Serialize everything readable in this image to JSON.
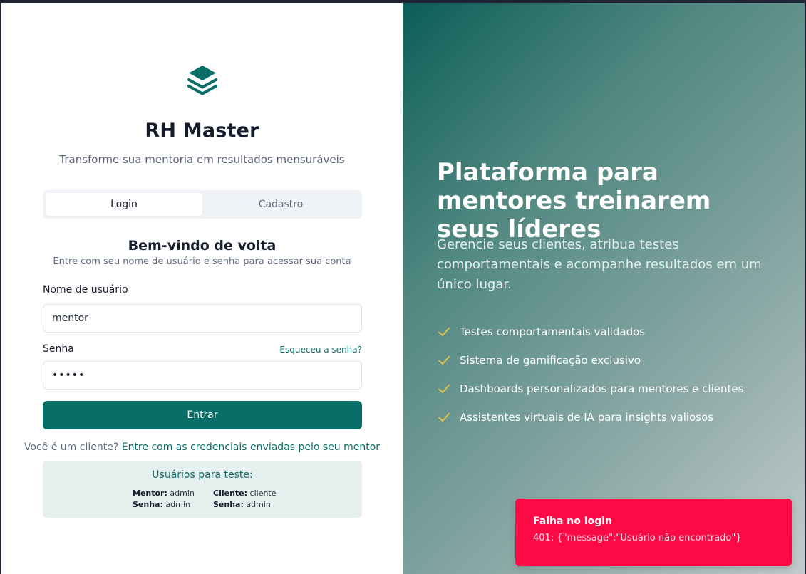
{
  "brand": {
    "app_name": "RH Master",
    "tagline": "Transforme sua mentoria em resultados mensuráveis",
    "icon": "layers-icon",
    "accent_color": "#0a6e68"
  },
  "tabs": [
    {
      "label": "Login",
      "active": true
    },
    {
      "label": "Cadastro",
      "active": false
    }
  ],
  "login": {
    "heading": "Bem-vindo de volta",
    "subheading": "Entre com seu nome de usuário e senha para acessar sua conta",
    "username_label": "Nome de usuário",
    "username_value": "mentor",
    "password_label": "Senha",
    "password_value": "•••••",
    "forgot_link": "Esqueceu a senha?",
    "submit_label": "Entrar",
    "client_prompt": "Você é um cliente?",
    "client_link": "Entre com as credenciais enviadas pelo seu mentor"
  },
  "test_users": {
    "title": "Usuários para teste:",
    "mentor_key": "Mentor:",
    "mentor_user": "admin",
    "mentor_pass_key": "Senha:",
    "mentor_pass": "admin",
    "client_key": "Cliente:",
    "client_user": "cliente",
    "client_pass_key": "Senha:",
    "client_pass": "admin"
  },
  "promo": {
    "headline": "Plataforma para mentores treinarem seus líderes",
    "description": "Gerencie seus clientes, atribua testes comportamentais e acompanhe resultados em um único lugar.",
    "features": [
      "Testes comportamentais validados",
      "Sistema de gamificação exclusivo",
      "Dashboards personalizados para mentores e clientes",
      "Assistentes virtuais de IA para insights valiosos"
    ],
    "check_color": "#e2c24a"
  },
  "toast": {
    "title": "Falha no login",
    "message": "401: {\"message\":\"Usuário não encontrado\"}",
    "color": "#fb0a45"
  }
}
